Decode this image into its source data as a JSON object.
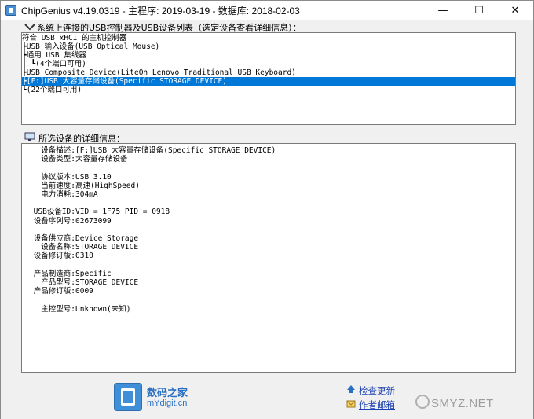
{
  "window": {
    "title": "ChipGenius v4.19.0319 - 主程序: 2019-03-19 - 数据库: 2018-02-03",
    "minimize_glyph": "—",
    "maximize_glyph": "☐",
    "close_glyph": "✕"
  },
  "devices": {
    "label": "系统上连接的USB控制器及USB设备列表（选定设备查看详细信息）：",
    "items": [
      {
        "text": "符合 USB xHCI 的主机控制器"
      },
      {
        "text": "┣USB 输入设备(USB Optical Mouse)"
      },
      {
        "text": "┣通用 USB 集线器"
      },
      {
        "text": "┃ ┗(4个端口可用)"
      },
      {
        "text": "┣USB Composite Device(LiteOn Lenovo Traditional USB Keyboard)"
      },
      {
        "text": "┣[F:]USB 大容量存储设备(Specific STORAGE DEVICE)"
      },
      {
        "text": "┗(22个端口可用)"
      }
    ],
    "selected_index": 5
  },
  "details": {
    "label": "所选设备的详细信息：",
    "rows": [
      {
        "key": "设备描述:",
        "val": "[F:]USB 大容量存储设备(Specific STORAGE DEVICE)"
      },
      {
        "key": "设备类型:",
        "val": "大容量存储设备"
      },
      {
        "key": "",
        "val": ""
      },
      {
        "key": "协议版本:",
        "val": "USB 3.10"
      },
      {
        "key": "当前速度:",
        "val": "高速(HighSpeed)"
      },
      {
        "key": "电力消耗:",
        "val": "304mA"
      },
      {
        "key": "",
        "val": ""
      },
      {
        "key": "USB设备ID:",
        "val": "VID = 1F75 PID = 0918"
      },
      {
        "key": "设备序列号:",
        "val": "02673099"
      },
      {
        "key": "",
        "val": ""
      },
      {
        "key": "设备供应商:",
        "val": "Device Storage"
      },
      {
        "key": "设备名称:",
        "val": "STORAGE DEVICE"
      },
      {
        "key": "设备修订版:",
        "val": "0310"
      },
      {
        "key": "",
        "val": ""
      },
      {
        "key": "产品制造商:",
        "val": "Specific"
      },
      {
        "key": "产品型号:",
        "val": "STORAGE DEVICE"
      },
      {
        "key": "产品修订版:",
        "val": "0009"
      },
      {
        "key": "",
        "val": ""
      },
      {
        "key": "主控型号:",
        "val": "Unknown(未知)"
      }
    ]
  },
  "footer": {
    "logo_name": "数码之家",
    "logo_url": "mYdigit.cn",
    "update_link": "检查更新",
    "mail_link": "作者邮箱",
    "watermark": "SMYZ.NET"
  },
  "colors": {
    "selection": "#0078d7",
    "link": "#1a3fb0",
    "brand": "#3f8fd8"
  }
}
